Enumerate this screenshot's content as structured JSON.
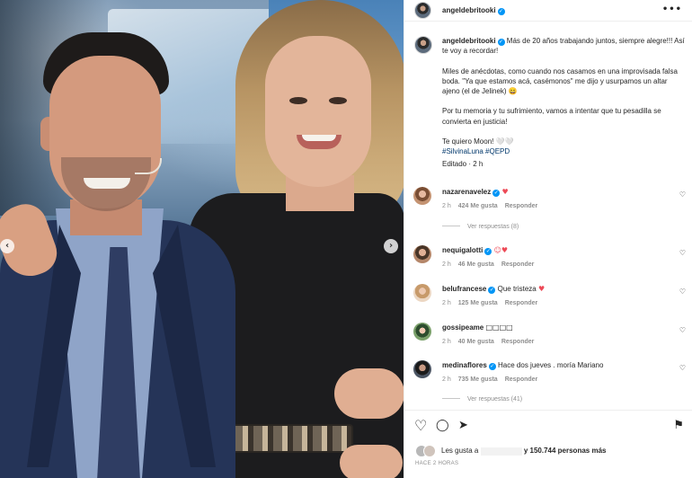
{
  "post": {
    "username": "angeldebritooki",
    "verified_mark": "✓",
    "more_label": "•••",
    "caption": {
      "line1": "Más de 20 años trabajando juntos, siempre alegre!!! Así te voy a recordar!",
      "line2": "Miles de anécdotas, como cuando nos casamos en una improvisada falsa boda. \"Ya que estamos acá, casémonos\" me dijo y usurpamos un altar ajeno (el de Jelinek) 😄",
      "line3": "Por tu memoria y tu sufrimiento, vamos a intentar que tu pesadilla se convierta en justicia!",
      "line4": "Te quiero Moon! 🤍🤍",
      "hashtag1": "#SilvinaLuna",
      "hashtag2": "#QEPD"
    },
    "edited": "Editado · 2 h"
  },
  "media": {
    "prev_icon": "‹",
    "next_icon": "›"
  },
  "comments": [
    {
      "user": "nazarenavelez",
      "verified": true,
      "text": "",
      "emoji": "♥",
      "time": "2 h",
      "likes": "424 Me gusta",
      "reply": "Responder",
      "replies": "Ver respuestas (8)"
    },
    {
      "user": "nequigalotti",
      "verified": true,
      "text": "",
      "emoji": "☺♥",
      "time": "2 h",
      "likes": "46 Me gusta",
      "reply": "Responder",
      "replies": ""
    },
    {
      "user": "belufrancese",
      "verified": true,
      "text": "Que tristeza",
      "emoji": "♥",
      "time": "2 h",
      "likes": "125 Me gusta",
      "reply": "Responder",
      "replies": ""
    },
    {
      "user": "gossipeame",
      "verified": false,
      "text": "□□□□",
      "emoji": "",
      "time": "2 h",
      "likes": "40 Me gusta",
      "reply": "Responder",
      "replies": ""
    },
    {
      "user": "medinaflores",
      "verified": true,
      "text": "Hace dos jueves . moría Mariano",
      "emoji": "",
      "time": "2 h",
      "likes": "735 Me gusta",
      "reply": "Responder",
      "replies": "Ver respuestas (41)"
    }
  ],
  "comment_heart": "♡",
  "footer": {
    "like_icon": "♡",
    "comment_icon": "◯",
    "share_icon": "➤",
    "save_icon": "⚑",
    "likes_prefix": "Les gusta a",
    "likes_suffix": "y 150.744 personas más",
    "timestamp": "HACE 2 HORAS"
  }
}
